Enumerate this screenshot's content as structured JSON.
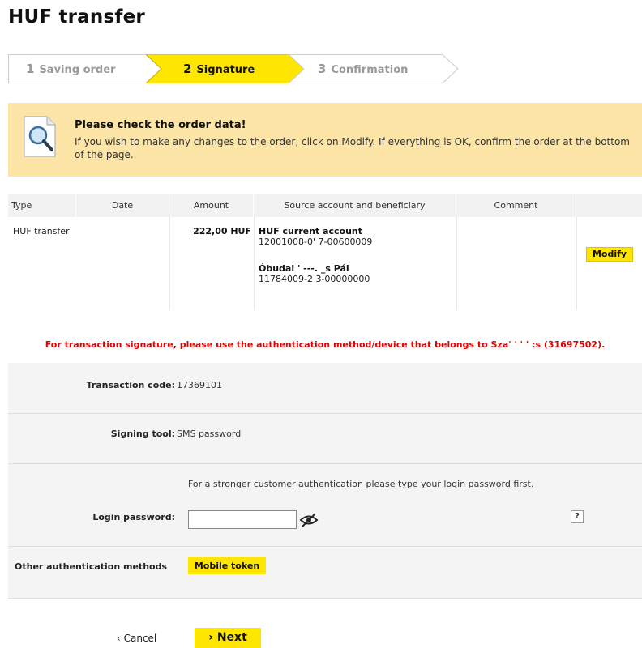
{
  "page": {
    "title": "HUF transfer"
  },
  "steps": [
    {
      "num": "1",
      "label": "Saving order",
      "state": "done"
    },
    {
      "num": "2",
      "label": "Signature",
      "state": "active"
    },
    {
      "num": "3",
      "label": "Confirmation",
      "state": "pending"
    }
  ],
  "notice": {
    "icon": "magnifier-icon",
    "title": "Please check the order data!",
    "text": "If you wish to make any changes to the order, click on Modify. If everything is OK, confirm the order at the bottom of the page."
  },
  "table": {
    "headers": [
      "Type",
      "Date",
      "Amount",
      "Source account and beneficiary",
      "Comment",
      ""
    ],
    "row": {
      "type": "HUF transfer",
      "date": "",
      "amount": "222,00 HUF",
      "source_name": "HUF current account",
      "source_account": "12001008-0'           7-00600009",
      "beneficiary_name": "Óbudai '          ---. _s Pál",
      "beneficiary_account": "11784009-2             3-00000000",
      "comment": "",
      "modify_label": "Modify"
    }
  },
  "warning": "For transaction signature, please use the authentication method/device that belongs to Sza'     '   '          '  :s (31697502).",
  "signature": {
    "transaction_code_label": "Transaction code:",
    "transaction_code": "17369101",
    "signing_tool_label": "Signing tool:",
    "signing_tool": "SMS password",
    "login_hint": "For a stronger customer authentication please type your login password first.",
    "login_password_label": "Login password:",
    "login_password_value": "",
    "help_label": "?",
    "other_methods_label": "Other authentication methods",
    "mobile_token_label": "Mobile token"
  },
  "footer": {
    "cancel_label": "‹ Cancel",
    "next_label": "› Next"
  },
  "colors": {
    "accent": "#ffe600",
    "notice_bg": "#fde5a7",
    "warning": "#e60000",
    "form_bg": "#f4f4f4"
  }
}
